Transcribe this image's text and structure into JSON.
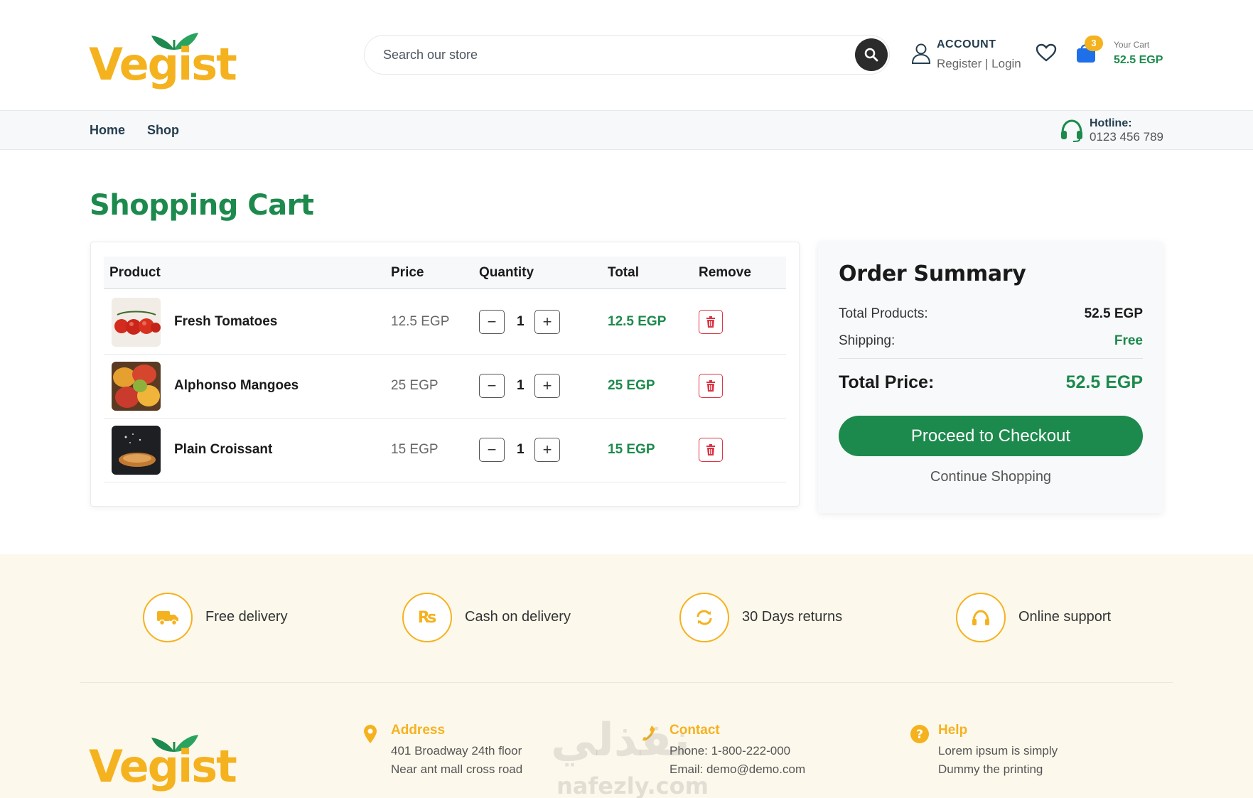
{
  "brand": {
    "name": "Vegist",
    "primary": "#1d8a4d",
    "accent": "#f5b21f",
    "danger": "#dc3545"
  },
  "header": {
    "search_placeholder": "Search our store",
    "account_title": "ACCOUNT",
    "account_sub": "Register | Login",
    "cart_count": "3",
    "cart_label": "Your Cart",
    "cart_total": "52.5 EGP"
  },
  "nav": {
    "items": [
      "Home",
      "Shop"
    ],
    "hotline_title": "Hotline:",
    "hotline_number": "0123 456 789"
  },
  "page_title": "Shopping Cart",
  "cart": {
    "columns": [
      "Product",
      "Price",
      "Quantity",
      "Total",
      "Remove"
    ],
    "rows": [
      {
        "name": "Fresh Tomatoes",
        "price": "12.5 EGP",
        "qty": "1",
        "total": "12.5 EGP"
      },
      {
        "name": "Alphonso Mangoes",
        "price": "25 EGP",
        "qty": "1",
        "total": "25 EGP"
      },
      {
        "name": "Plain Croissant",
        "price": "15 EGP",
        "qty": "1",
        "total": "15 EGP"
      }
    ]
  },
  "summary": {
    "title": "Order Summary",
    "total_products_label": "Total Products:",
    "total_products_value": "52.5 EGP",
    "shipping_label": "Shipping:",
    "shipping_value": "Free",
    "total_price_label": "Total Price:",
    "total_price_value": "52.5 EGP",
    "checkout_label": "Proceed to Checkout",
    "continue_label": "Continue Shopping"
  },
  "features": [
    {
      "icon": "truck-icon",
      "label": "Free delivery"
    },
    {
      "icon": "rupee-icon",
      "label": "Cash on delivery"
    },
    {
      "icon": "refresh-icon",
      "label": "30 Days returns"
    },
    {
      "icon": "headphones-icon",
      "label": "Online support"
    }
  ],
  "footer": {
    "address": {
      "title": "Address",
      "lines": [
        "401 Broadway 24th floor",
        "Near ant mall cross road"
      ]
    },
    "contact": {
      "title": "Contact",
      "lines": [
        "Phone: 1-800-222-000",
        "Email: demo@demo.com"
      ]
    },
    "help": {
      "title": "Help",
      "lines": [
        "Lorem ipsum is simply",
        "Dummy the printing"
      ]
    }
  },
  "watermark": {
    "arabic": "نفذلي",
    "latin": "nafezly.com"
  }
}
